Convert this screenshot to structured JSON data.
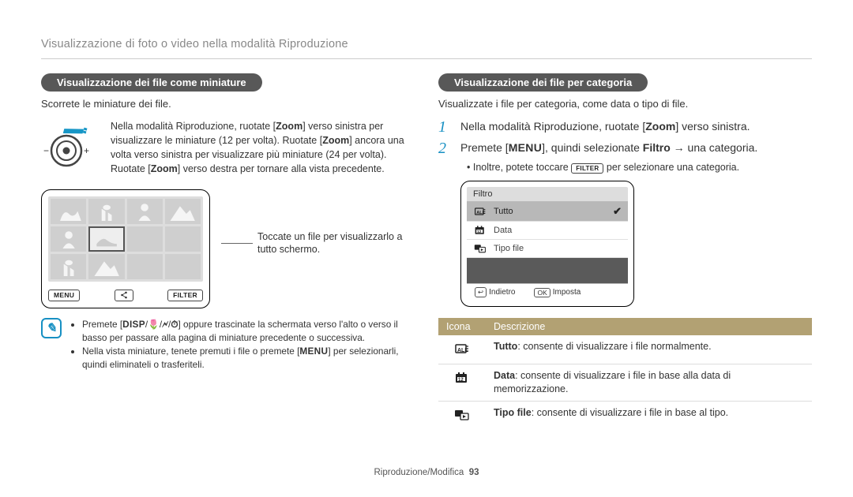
{
  "page_title": "Visualizzazione di foto o video nella modalità Riproduzione",
  "left": {
    "heading": "Visualizzazione dei file come miniature",
    "intro": "Scorrete le miniature dei file.",
    "zoom_para": "Nella modalità Riproduzione, ruotate [Zoom] verso sinistra per visualizzare le miniature (12 per volta). Ruotate [Zoom] ancora una volta verso sinistra per visualizzare più miniature (24 per volta). Ruotate [Zoom] verso destra per tornare alla vista precedente.",
    "leader": "Toccate un file per visualizzarlo a tutto schermo.",
    "lcd_menu": "MENU",
    "lcd_filter": "FILTER",
    "note1": "Premete [DISP/ 🌷 / 🗲 / ⏱] oppure trascinate la schermata verso l'alto o verso il basso per passare alla pagina di miniature precedente o successiva.",
    "note2": "Nella vista miniature, tenete premuti i file o premete [MENU] per selezionarli, quindi eliminateli o trasferiteli."
  },
  "right": {
    "heading": "Visualizzazione dei file per categoria",
    "intro": "Visualizzate i file per categoria, come data o tipo di file.",
    "step1": "Nella modalità Riproduzione, ruotate [Zoom] verso sinistra.",
    "step2_a": "Premete [",
    "step2_b": "MENU",
    "step2_c": "], quindi selezionate ",
    "step2_d": "Filtro",
    "step2_e": " → una categoria.",
    "sub_bullet_a": "Inoltre, potete toccare ",
    "sub_bullet_b": " per selezionare una categoria.",
    "filter_title": "Filtro",
    "f_row1": "Tutto",
    "f_row2": "Data",
    "f_row3": "Tipo file",
    "f_back": "Indietro",
    "f_set": "Imposta",
    "th_icon": "Icona",
    "th_desc": "Descrizione",
    "d1_a": "Tutto",
    "d1_b": ": consente di visualizzare i file normalmente.",
    "d2_a": "Data",
    "d2_b": ": consente di visualizzare i file in base alla data di memorizzazione.",
    "d3_a": "Tipo file",
    "d3_b": ": consente di visualizzare i file in base al tipo."
  },
  "footer_a": "Riproduzione/Modifica",
  "footer_b": "93"
}
